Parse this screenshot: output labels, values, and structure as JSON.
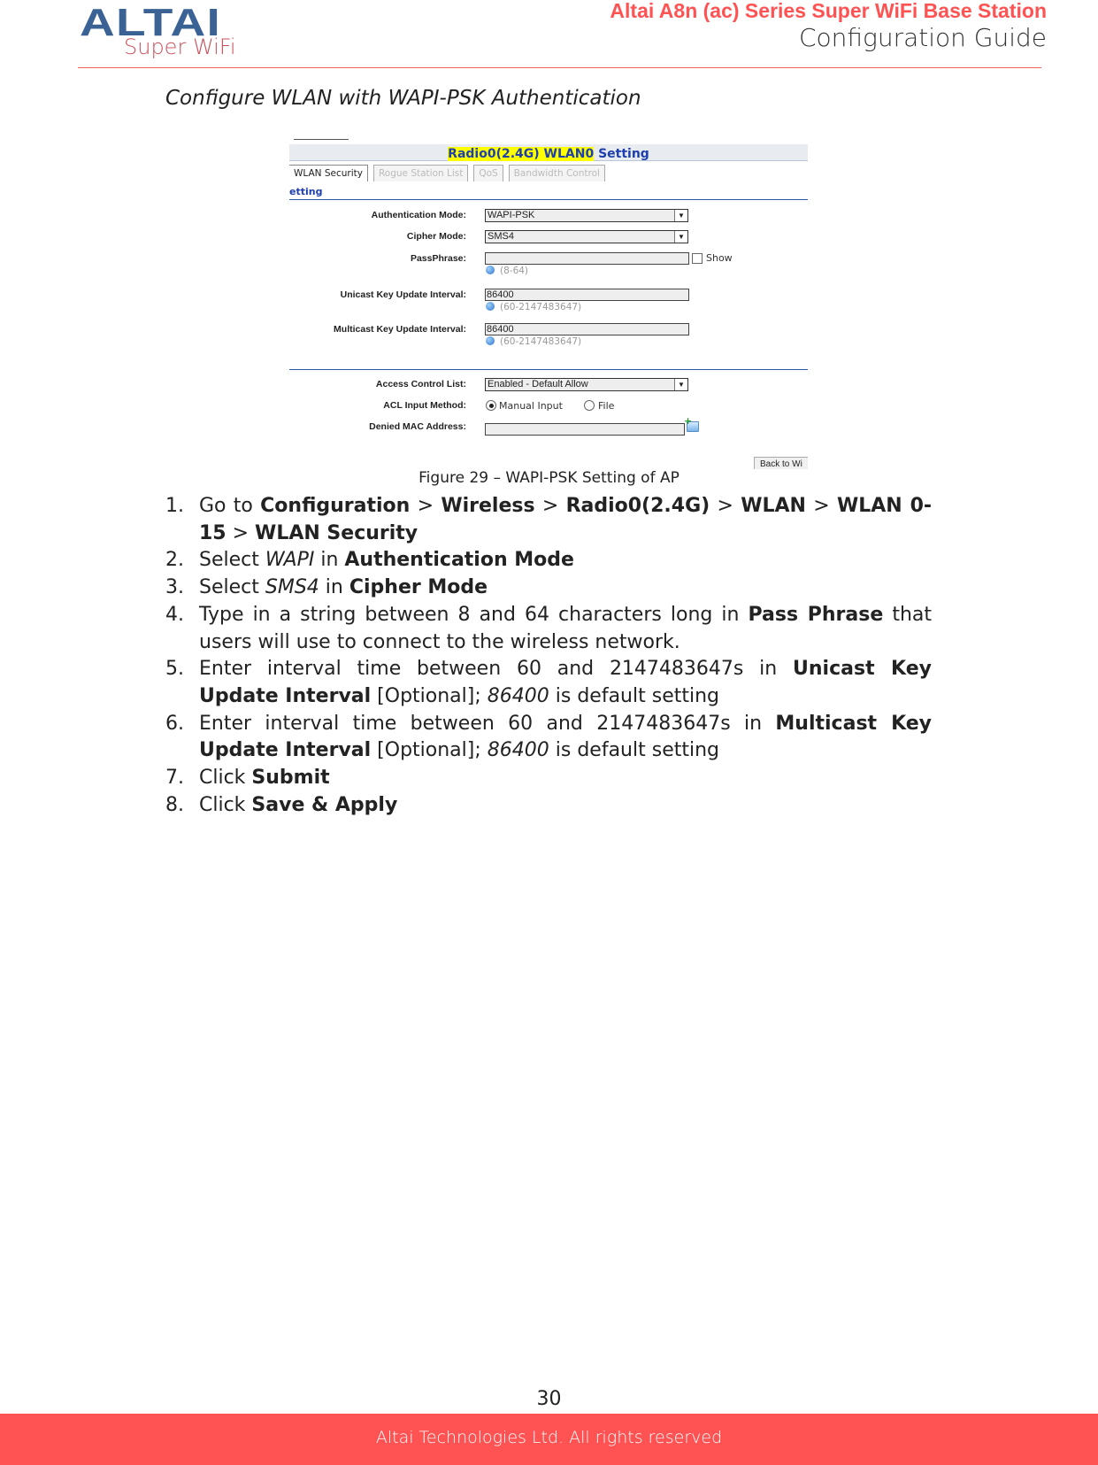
{
  "header": {
    "logo_word": "ALTAI",
    "logo_sub": "Super WiFi",
    "doc_title": "Altai A8n (ac) Series Super WiFi Base Station",
    "doc_subtitle": "Configuration Guide",
    "accent_color": "#ff5252",
    "logo_color": "#3a6294"
  },
  "section_title": "Configure WLAN with WAPI-PSK Authentication",
  "figure": {
    "title_highlight": "Radio0(2.4G) WLAN0",
    "title_rest": " Setting",
    "tabs": [
      {
        "label": "WLAN Security",
        "active": true
      },
      {
        "label": "Rogue Station List",
        "active": false
      },
      {
        "label": "QoS",
        "active": false
      },
      {
        "label": "Bandwidth Control",
        "active": false
      }
    ],
    "section_label": "etting",
    "fields": {
      "auth_mode": {
        "label": "Authentication Mode:",
        "value": "WAPI-PSK"
      },
      "cipher_mode": {
        "label": "Cipher Mode:",
        "value": "SMS4"
      },
      "passphrase": {
        "label": "PassPhrase:",
        "value": "",
        "show_label": "Show",
        "hint": "(8-64)"
      },
      "unicast": {
        "label": "Unicast Key Update Interval:",
        "value": "86400",
        "hint": "(60-2147483647)"
      },
      "multicast": {
        "label": "Multicast Key Update Interval:",
        "value": "86400",
        "hint": "(60-2147483647)"
      },
      "acl": {
        "label": "Access Control List:",
        "value": "Enabled - Default Allow"
      },
      "acl_method": {
        "label": "ACL Input Method:",
        "option1": "Manual Input",
        "option2": "File",
        "selected": "Manual Input"
      },
      "denied_mac": {
        "label": "Denied MAC Address:",
        "value": ""
      }
    },
    "back_button": "Back to Wi"
  },
  "caption": "Figure 29 – WAPI-PSK Setting of AP",
  "steps": [
    {
      "num": "1.",
      "parts": [
        [
          "t",
          "Go to "
        ],
        [
          "b",
          "Configuration"
        ],
        [
          "t",
          " > "
        ],
        [
          "b",
          "Wireless"
        ],
        [
          "t",
          " > "
        ],
        [
          "b",
          "Radio0(2.4G)"
        ],
        [
          "t",
          " > "
        ],
        [
          "b",
          "WLAN"
        ],
        [
          "t",
          " > "
        ],
        [
          "b",
          "WLAN 0-15"
        ],
        [
          "t",
          " > "
        ],
        [
          "b",
          "WLAN Security"
        ]
      ]
    },
    {
      "num": "2.",
      "parts": [
        [
          "t",
          "Select "
        ],
        [
          "i",
          "WAPI"
        ],
        [
          "t",
          " in "
        ],
        [
          "b",
          "Authentication Mode"
        ]
      ]
    },
    {
      "num": "3.",
      "parts": [
        [
          "t",
          "Select "
        ],
        [
          "i",
          "SMS4"
        ],
        [
          "t",
          " in "
        ],
        [
          "b",
          "Cipher Mode"
        ]
      ]
    },
    {
      "num": "4.",
      "parts": [
        [
          "t",
          "Type in a string between 8 and 64 characters long in "
        ],
        [
          "b",
          "Pass Phrase"
        ],
        [
          "t",
          " that users will use to connect to the wireless network."
        ]
      ]
    },
    {
      "num": "5.",
      "parts": [
        [
          "t",
          "Enter interval time between 60 and 2147483647s in "
        ],
        [
          "b",
          "Unicast Key Update Interval"
        ],
        [
          "t",
          " [Optional]; "
        ],
        [
          "i",
          "86400"
        ],
        [
          "t",
          " is default setting"
        ]
      ]
    },
    {
      "num": "6.",
      "parts": [
        [
          "t",
          "Enter interval time between 60 and 2147483647s in "
        ],
        [
          "b",
          "Multicast Key Update Interval"
        ],
        [
          "t",
          " [Optional]; "
        ],
        [
          "i",
          "86400"
        ],
        [
          "t",
          " is default setting"
        ]
      ]
    },
    {
      "num": "7.",
      "parts": [
        [
          "t",
          "Click "
        ],
        [
          "b",
          "Submit"
        ]
      ]
    },
    {
      "num": "8.",
      "parts": [
        [
          "t",
          "Click "
        ],
        [
          "b",
          "Save & Apply"
        ]
      ]
    }
  ],
  "page_number": "30",
  "footer": "Altai Technologies Ltd. All rights reserved"
}
